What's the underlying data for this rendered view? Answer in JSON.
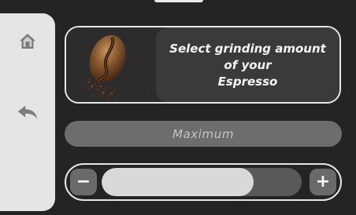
{
  "navigation": {
    "home_icon": "home-icon",
    "back_icon": "back-arrow-icon"
  },
  "info_card": {
    "image": "coffee-bean-image",
    "instruction": "Select grinding amount\nof your\nEspresso"
  },
  "grind_level": {
    "label": "Maximum"
  },
  "slider": {
    "decrease_label": "−",
    "increase_label": "+",
    "value_fraction": 0.76
  },
  "colors": {
    "background": "#242424",
    "sidebar": "#e5e5e5",
    "text_panel": "#3a3a3a",
    "level_pill": "#6d6d6d",
    "slider_fill": "#d9d9d9",
    "slider_track": "#595959"
  }
}
